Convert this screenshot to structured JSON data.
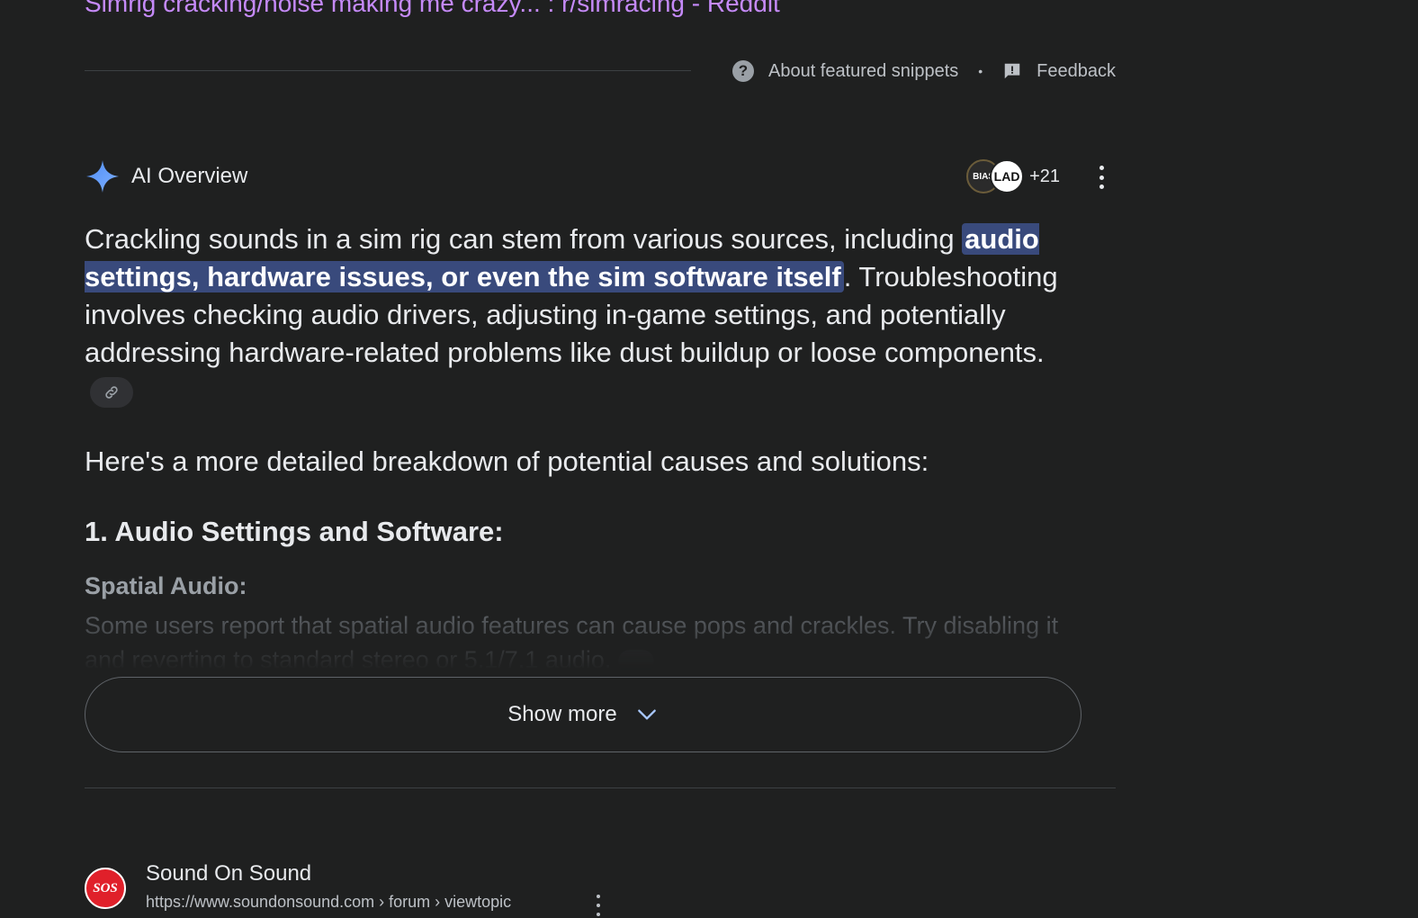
{
  "previous_result": {
    "title": "Simrig cracking/noise making me crazy... : r/simracing - Reddit"
  },
  "snippet_footer": {
    "about_label": "About featured snippets",
    "separator": "•",
    "feedback_label": "Feedback"
  },
  "ai_overview": {
    "label": "AI Overview",
    "sources": {
      "avatar_1": "BIAS",
      "avatar_2": "LAD",
      "extra_count": "+21"
    },
    "summary": {
      "part_1": "Crackling sounds in a sim rig can stem from various sources, including ",
      "highlight": "audio settings, hardware issues, or even the sim software itself",
      "part_2": ". Troubleshooting involves checking audio drivers, adjusting in-game settings, and potentially addressing hardware-related problems like dust buildup or loose components."
    },
    "breakdown_intro": "Here's a more detailed breakdown of potential causes and solutions:",
    "section_1_heading": "1. Audio Settings and Software:",
    "subsection_heading": "Spatial Audio:",
    "subsection_text": "Some users report that spatial audio features can cause pops and crackles. Try disabling it and reverting to standard stereo or 5.1/7.1 audio.",
    "show_more_label": "Show more"
  },
  "next_result": {
    "logo_text": "SOS",
    "site_name": "Sound On Sound",
    "url": "https://www.soundonsound.com › forum › viewtopic"
  },
  "colors": {
    "background": "#1f2020",
    "link_visited": "#c58af9",
    "highlight_bg": "#394a7c",
    "text_primary": "#e8eaed",
    "text_secondary": "#bdc1c6"
  }
}
